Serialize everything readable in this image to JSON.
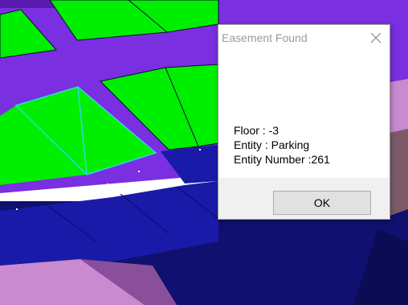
{
  "dialog": {
    "title": "Easement Found",
    "lines": {
      "floor": "Floor : -3",
      "entity": "Entity : Parking",
      "entity_number": "Entity Number :261"
    },
    "ok_label": "OK"
  },
  "colors": {
    "green": "#00ef00",
    "purple": "#7a2fe0",
    "navy": "#1a1aa8",
    "dark_navy": "#101070",
    "pink": "#c98ad0",
    "gray": "#7d5a6a",
    "highlight": "#2fd8e0"
  },
  "icons": {
    "close": "close-icon"
  }
}
